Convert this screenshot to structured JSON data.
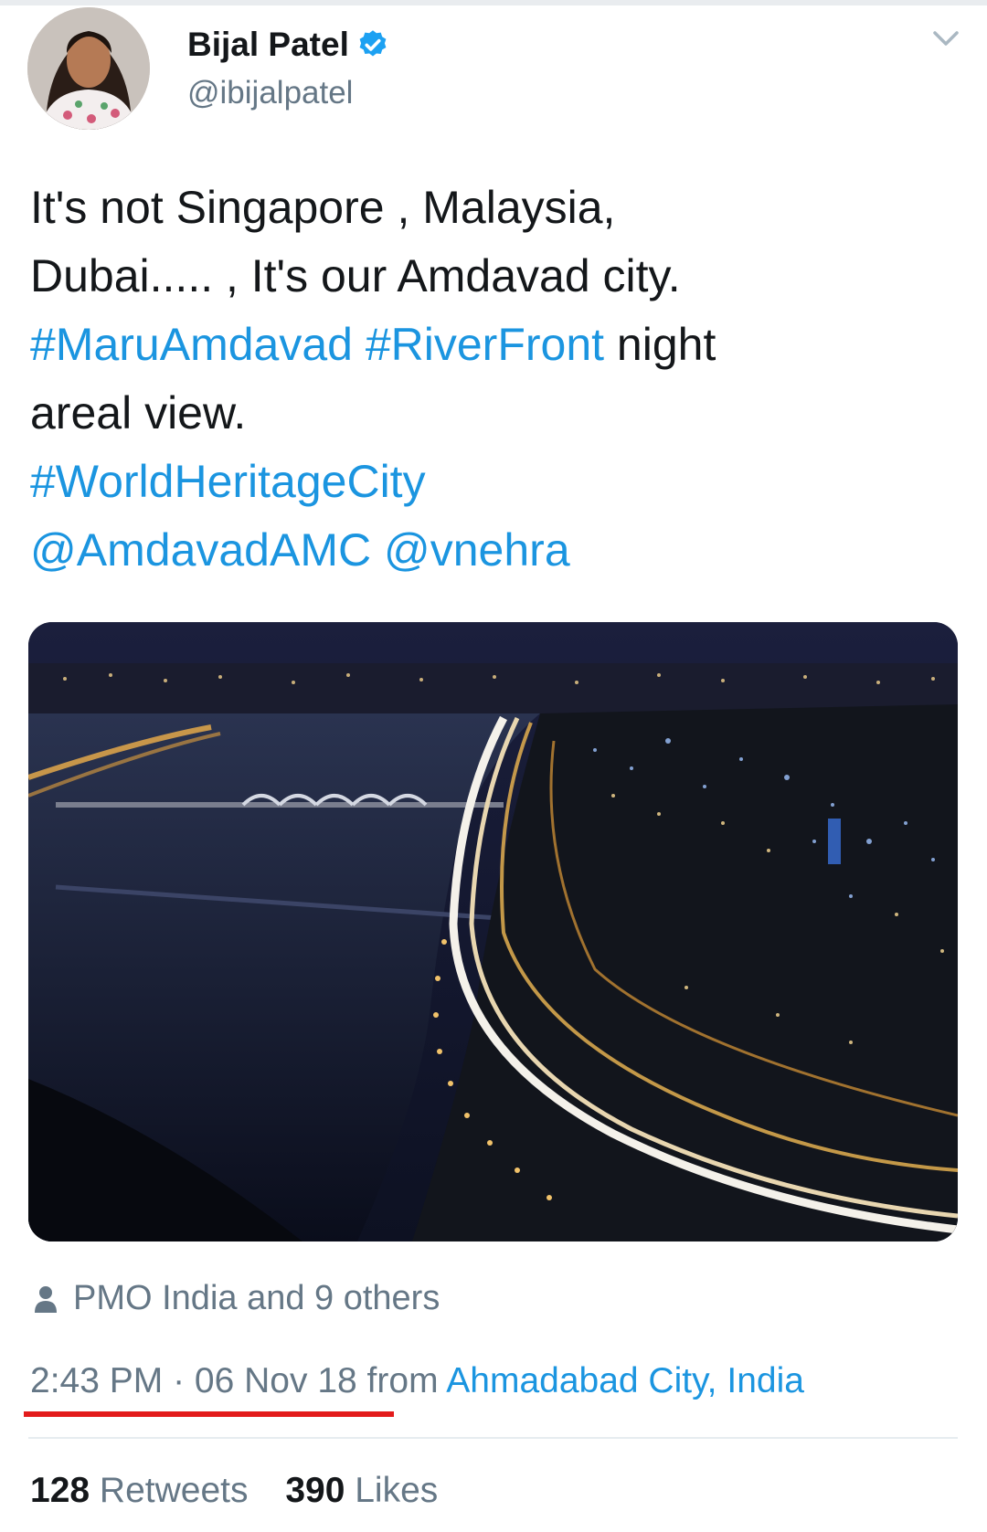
{
  "author": {
    "name": "Bijal Patel",
    "handle": "@ibijalpatel"
  },
  "tweet": {
    "lines": [
      [
        {
          "t": "It's not Singapore , Malaysia,",
          "link": false
        }
      ],
      [
        {
          "t": "Dubai..... , It's our Amdavad city.",
          "link": false
        }
      ],
      [
        {
          "t": "#MaruAmdavad #RiverFront",
          "link": true
        },
        {
          "t": " night",
          "link": false
        }
      ],
      [
        {
          "t": "areal view.",
          "link": false
        }
      ],
      [
        {
          "t": "#WorldHeritageCity",
          "link": true
        }
      ],
      [
        {
          "t": "@AmdavadAMC @vnehra",
          "link": true
        }
      ]
    ]
  },
  "liked_by": "PMO India and 9 others",
  "meta": {
    "time": "2:43 PM",
    "separator": " · ",
    "date": "06 Nov 18",
    "from": " from ",
    "location": "Ahmadabad City, India"
  },
  "stats": {
    "retweets_count": "128",
    "retweets_label": " Retweets",
    "likes_count": "390",
    "likes_label": " Likes"
  },
  "colors": {
    "link": "#1b95e0",
    "secondary_text": "#657786",
    "underline": "#e31b1b",
    "verified": "#1da1f2"
  },
  "icons": [
    "verified-badge-icon",
    "chevron-down-icon",
    "person-icon"
  ]
}
